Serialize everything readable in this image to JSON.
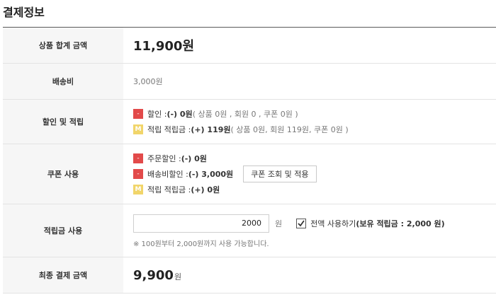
{
  "title": "결제정보",
  "rows": {
    "subtotal": {
      "label": "상품 합계 금액",
      "amount": "11,900원"
    },
    "shipping": {
      "label": "배송비",
      "amount": "3,000원"
    },
    "discount": {
      "label": "할인 및 적립",
      "discount_badge": "-",
      "discount_prefix": "할인 : ",
      "discount_value": "(-) 0원",
      "discount_detail": " ( 상품 0원 , 회원 0 , 쿠폰 0원 )",
      "mileage_badge": "M",
      "mileage_prefix": "적립 적립금 : ",
      "mileage_value": "(+) 119원",
      "mileage_detail": " ( 상품 0원, 회원 119원, 쿠폰 0원 )"
    },
    "coupon": {
      "label": "쿠폰 사용",
      "order_discount_badge": "-",
      "order_discount_prefix": "주문할인 : ",
      "order_discount_value": "(-) 0원",
      "ship_discount_badge": "-",
      "ship_discount_prefix": "배송비할인 : ",
      "ship_discount_value": "(-) 3,000원",
      "lookup_button": "쿠폰 조회 및 적용",
      "mileage_badge": "M",
      "mileage_prefix": "적립 적립금 : ",
      "mileage_value": "(+) 0원"
    },
    "points": {
      "label": "적립금 사용",
      "input_value": "2000",
      "unit": "원",
      "use_all_checked": true,
      "use_all_label": "전액 사용하기 ",
      "use_all_detail": "(보유 적립금 : 2,000 원)",
      "note": "※ 100원부터 2,000원까지 사용 가능합니다."
    },
    "total": {
      "label": "최종 결제 금액",
      "amount": "9,900",
      "unit": "원"
    }
  },
  "colors": {
    "minus_badge": "#e24a4a",
    "mileage_badge": "#f1d56a",
    "label_bg": "#f6f6f6"
  }
}
